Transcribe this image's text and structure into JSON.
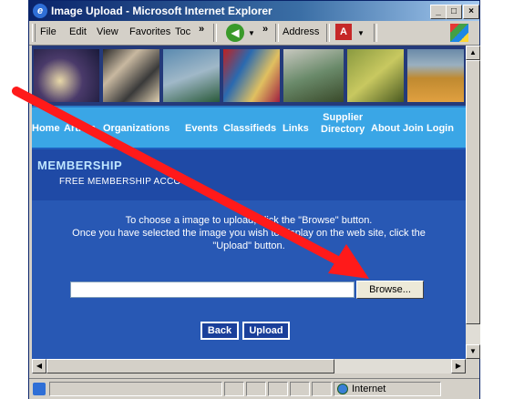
{
  "window": {
    "title": "Image Upload - Microsoft Internet Explorer",
    "controls": {
      "minimize": "_",
      "maximize": "□",
      "close": "×"
    }
  },
  "menu": {
    "items": [
      "File",
      "Edit",
      "View",
      "Favorites",
      "Toc"
    ],
    "chevron": "»",
    "address_label": "Address"
  },
  "site": {
    "nav": [
      "Home",
      "Artists",
      "Organizations",
      "Events",
      "Classifieds",
      "Links",
      "Supplier Directory",
      "About",
      "Join",
      "Login"
    ],
    "nav_supplier_line1": "Supplier",
    "nav_supplier_line2": "Directory",
    "section_title": "MEMBERSHIP",
    "section_subtitle": "FREE MEMBERSHIP ACCOU...",
    "instruction_line1": "To choose a image to upload, click the \"Browse\" button.",
    "instruction_line2": "Once you have selected the image you wish to display on the web site, click the",
    "instruction_line3": "\"Upload\" button.",
    "file_value": "",
    "browse_label": "Browse...",
    "back_label": "Back",
    "upload_label": "Upload"
  },
  "status": {
    "zone": "Internet"
  },
  "colors": {
    "annotation_arrow": "#ff1a1a",
    "page_bg": "#2858b4",
    "nav_bg": "#3aa6e6"
  },
  "icons": [
    "ie-logo-icon",
    "back-icon",
    "forward-icon",
    "acrobat-icon",
    "windows-flag-icon",
    "globe-icon"
  ]
}
